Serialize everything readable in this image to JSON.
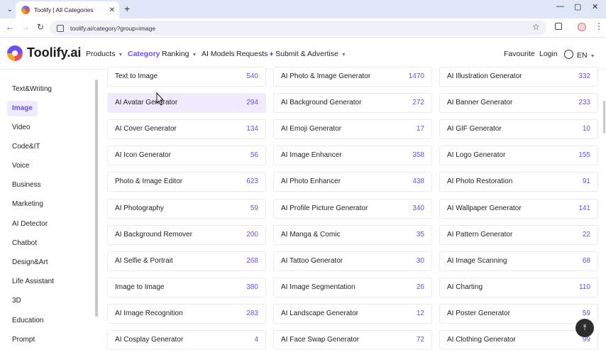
{
  "browser": {
    "tab_title": "Toolify | All Categories",
    "url": "toolify.ai/category?group=image",
    "new_tab": "+",
    "close": "✕",
    "minimize": "—",
    "maximize": "▢",
    "window_close": "✕",
    "icons": [
      "tab-menu-icon",
      "back-icon",
      "forward-icon",
      "reload-icon",
      "site-info-icon",
      "star-icon",
      "extensions-icon",
      "profile-icon",
      "kebab-menu-icon"
    ]
  },
  "header": {
    "logo": "Toolify.ai",
    "nav": [
      {
        "label": "Products",
        "caret": true
      },
      {
        "label": "Category",
        "caret": false
      },
      {
        "label": "Ranking",
        "caret": true
      },
      {
        "label": "AI Models",
        "caret": false
      },
      {
        "label": "Requests",
        "caret": false
      },
      {
        "label": "Submit & Advertise",
        "caret": true
      }
    ],
    "favourite": "Favourite",
    "login": "Login",
    "language": "EN"
  },
  "sidebar": {
    "items": [
      "Text&Writing",
      "Image",
      "Video",
      "Code&IT",
      "Voice",
      "Business",
      "Marketing",
      "AI Detector",
      "Chatbot",
      "Design&Art",
      "Life Assistant",
      "3D",
      "Education",
      "Prompt"
    ],
    "active": "Image"
  },
  "grid": [
    [
      {
        "name": "Text to Image",
        "count": "540"
      },
      {
        "name": "AI Photo & Image Generator",
        "count": "1470"
      },
      {
        "name": "AI Illustration Generator",
        "count": "332"
      }
    ],
    [
      {
        "name": "AI Avatar Generator",
        "count": "294"
      },
      {
        "name": "AI Background Generator",
        "count": "272"
      },
      {
        "name": "AI Banner Generator",
        "count": "233"
      }
    ],
    [
      {
        "name": "AI Cover Generator",
        "count": "134"
      },
      {
        "name": "AI Emoji Generator",
        "count": "17"
      },
      {
        "name": "AI GIF Generator",
        "count": "10"
      }
    ],
    [
      {
        "name": "AI Icon Generator",
        "count": "56"
      },
      {
        "name": "AI Image Enhancer",
        "count": "358"
      },
      {
        "name": "AI Logo Generator",
        "count": "155"
      }
    ],
    [
      {
        "name": "Photo & Image Editor",
        "count": "623"
      },
      {
        "name": "AI Photo Enhancer",
        "count": "438"
      },
      {
        "name": "AI Photo Restoration",
        "count": "91"
      }
    ],
    [
      {
        "name": "AI Photography",
        "count": "59"
      },
      {
        "name": "AI Profile Picture Generator",
        "count": "340"
      },
      {
        "name": "AI Wallpaper Generator",
        "count": "141"
      }
    ],
    [
      {
        "name": "AI Background Remover",
        "count": "200"
      },
      {
        "name": "AI Manga & Comic",
        "count": "35"
      },
      {
        "name": "AI Pattern Generator",
        "count": "22"
      }
    ],
    [
      {
        "name": "AI Selfie & Portrait",
        "count": "268"
      },
      {
        "name": "AI Tattoo Generator",
        "count": "30"
      },
      {
        "name": "AI Image Scanning",
        "count": "68"
      }
    ],
    [
      {
        "name": "Image to Image",
        "count": "380"
      },
      {
        "name": "AI Image Segmentation",
        "count": "26"
      },
      {
        "name": "AI Charting",
        "count": "110"
      }
    ],
    [
      {
        "name": "AI Image Recognition",
        "count": "283"
      },
      {
        "name": "AI Landscape Generator",
        "count": "12"
      },
      {
        "name": "AI Poster Generator",
        "count": "59"
      }
    ],
    [
      {
        "name": "AI Cosplay Generator",
        "count": "4"
      },
      {
        "name": "AI Face Swap Generator",
        "count": "72"
      },
      {
        "name": "AI Clothing Generator",
        "count": "99"
      }
    ]
  ],
  "hovered": "AI Avatar Generator",
  "accent": "#6d4bf5"
}
